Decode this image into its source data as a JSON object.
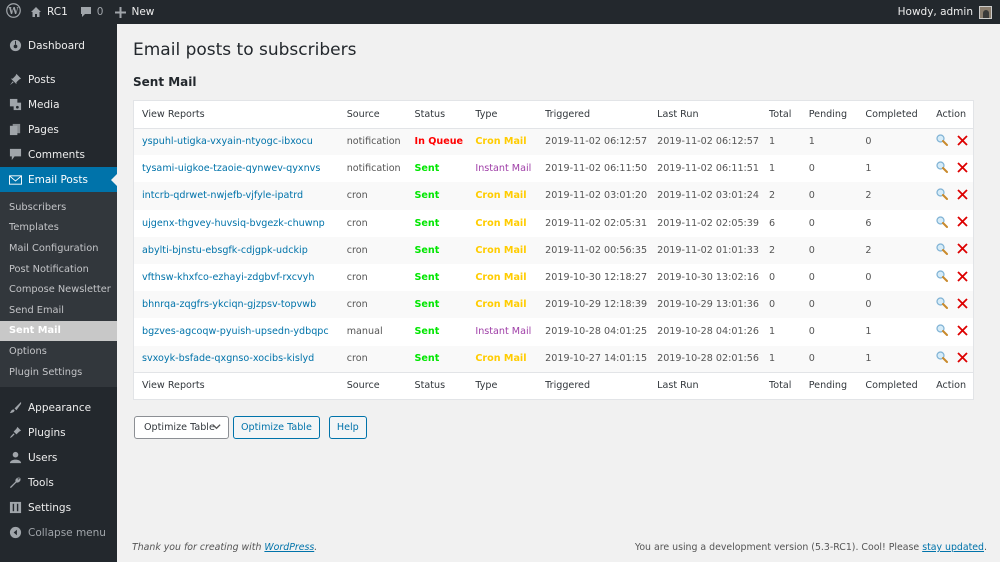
{
  "adminbar": {
    "site_name": "RC1",
    "comments_count": "0",
    "new_label": "New",
    "howdy": "Howdy, admin"
  },
  "sidebar": {
    "items_top": [
      {
        "label": "Dashboard",
        "icon": "dashboard-icon"
      },
      {
        "label": "Posts",
        "icon": "pin-icon"
      },
      {
        "label": "Media",
        "icon": "media-icon"
      },
      {
        "label": "Pages",
        "icon": "pages-icon"
      },
      {
        "label": "Comments",
        "icon": "comment-icon"
      },
      {
        "label": "Email Posts",
        "icon": "email-icon",
        "current": true
      }
    ],
    "submenu": [
      {
        "label": "Subscribers"
      },
      {
        "label": "Templates"
      },
      {
        "label": "Mail Configuration"
      },
      {
        "label": "Post Notification"
      },
      {
        "label": "Compose Newsletter"
      },
      {
        "label": "Send Email"
      },
      {
        "label": "Sent Mail",
        "current": true
      },
      {
        "label": "Options"
      },
      {
        "label": "Plugin Settings"
      }
    ],
    "items_bottom": [
      {
        "label": "Appearance",
        "icon": "brush-icon"
      },
      {
        "label": "Plugins",
        "icon": "plugin-icon"
      },
      {
        "label": "Users",
        "icon": "user-icon"
      },
      {
        "label": "Tools",
        "icon": "wrench-icon"
      },
      {
        "label": "Settings",
        "icon": "settings-icon"
      }
    ],
    "collapse_label": "Collapse menu"
  },
  "page": {
    "title": "Email posts to subscribers",
    "section": "Sent Mail"
  },
  "table": {
    "columns": [
      "View Reports",
      "Source",
      "Status",
      "Type",
      "Triggered",
      "Last Run",
      "Total",
      "Pending",
      "Completed",
      "Action"
    ],
    "rows": [
      {
        "report": "yspuhl-utigka-vxyain-ntyogc-ibxocu",
        "source": "notification",
        "status": "In Queue",
        "type": "Cron Mail",
        "triggered": "2019-11-02 06:12:57",
        "last_run": "2019-11-02 06:12:57",
        "total": "1",
        "pending": "1",
        "completed": "0"
      },
      {
        "report": "tysami-uigkoe-tzaoie-qynwev-qyxnvs",
        "source": "notification",
        "status": "Sent",
        "type": "Instant Mail",
        "triggered": "2019-11-02 06:11:50",
        "last_run": "2019-11-02 06:11:51",
        "total": "1",
        "pending": "0",
        "completed": "1"
      },
      {
        "report": "intcrb-qdrwet-nwjefb-vjfyle-ipatrd",
        "source": "cron",
        "status": "Sent",
        "type": "Cron Mail",
        "triggered": "2019-11-02 03:01:20",
        "last_run": "2019-11-02 03:01:24",
        "total": "2",
        "pending": "0",
        "completed": "2"
      },
      {
        "report": "ujgenx-thgvey-huvsiq-bvgezk-chuwnp",
        "source": "cron",
        "status": "Sent",
        "type": "Cron Mail",
        "triggered": "2019-11-02 02:05:31",
        "last_run": "2019-11-02 02:05:39",
        "total": "6",
        "pending": "0",
        "completed": "6"
      },
      {
        "report": "abylti-bjnstu-ebsgfk-cdjgpk-udckip",
        "source": "cron",
        "status": "Sent",
        "type": "Cron Mail",
        "triggered": "2019-11-02 00:56:35",
        "last_run": "2019-11-02 01:01:33",
        "total": "2",
        "pending": "0",
        "completed": "2"
      },
      {
        "report": "vfthsw-khxfco-ezhayi-zdgbvf-rxcvyh",
        "source": "cron",
        "status": "Sent",
        "type": "Cron Mail",
        "triggered": "2019-10-30 12:18:27",
        "last_run": "2019-10-30 13:02:16",
        "total": "0",
        "pending": "0",
        "completed": "0"
      },
      {
        "report": "bhnrqa-zqgfrs-ykciqn-gjzpsv-topvwb",
        "source": "cron",
        "status": "Sent",
        "type": "Cron Mail",
        "triggered": "2019-10-29 12:18:39",
        "last_run": "2019-10-29 13:01:36",
        "total": "0",
        "pending": "0",
        "completed": "0"
      },
      {
        "report": "bgzves-agcoqw-pyuish-upsedn-ydbqpc",
        "source": "manual",
        "status": "Sent",
        "type": "Instant Mail",
        "triggered": "2019-10-28 04:01:25",
        "last_run": "2019-10-28 04:01:26",
        "total": "1",
        "pending": "0",
        "completed": "1"
      },
      {
        "report": "svxoyk-bsfade-qxgnso-xocibs-kislyd",
        "source": "cron",
        "status": "Sent",
        "type": "Cron Mail",
        "triggered": "2019-10-27 14:01:15",
        "last_run": "2019-10-28 02:01:56",
        "total": "1",
        "pending": "0",
        "completed": "1"
      }
    ]
  },
  "actions": {
    "select_value": "Optimize Table",
    "apply_label": "Optimize Table",
    "help_label": "Help"
  },
  "footer": {
    "left_prefix": "Thank you for creating with ",
    "left_link": "WordPress",
    "left_suffix": ".",
    "right_prefix": "You are using a development version (5.3-RC1). Cool! Please ",
    "right_link": "stay updated",
    "right_suffix": "."
  },
  "colors": {
    "accent": "#0073aa",
    "status_in_queue": "#ff0000",
    "status_sent": "#00e600",
    "type_cron": "#ffcc00",
    "type_instant": "#a040a8",
    "delete": "#dd0000"
  }
}
